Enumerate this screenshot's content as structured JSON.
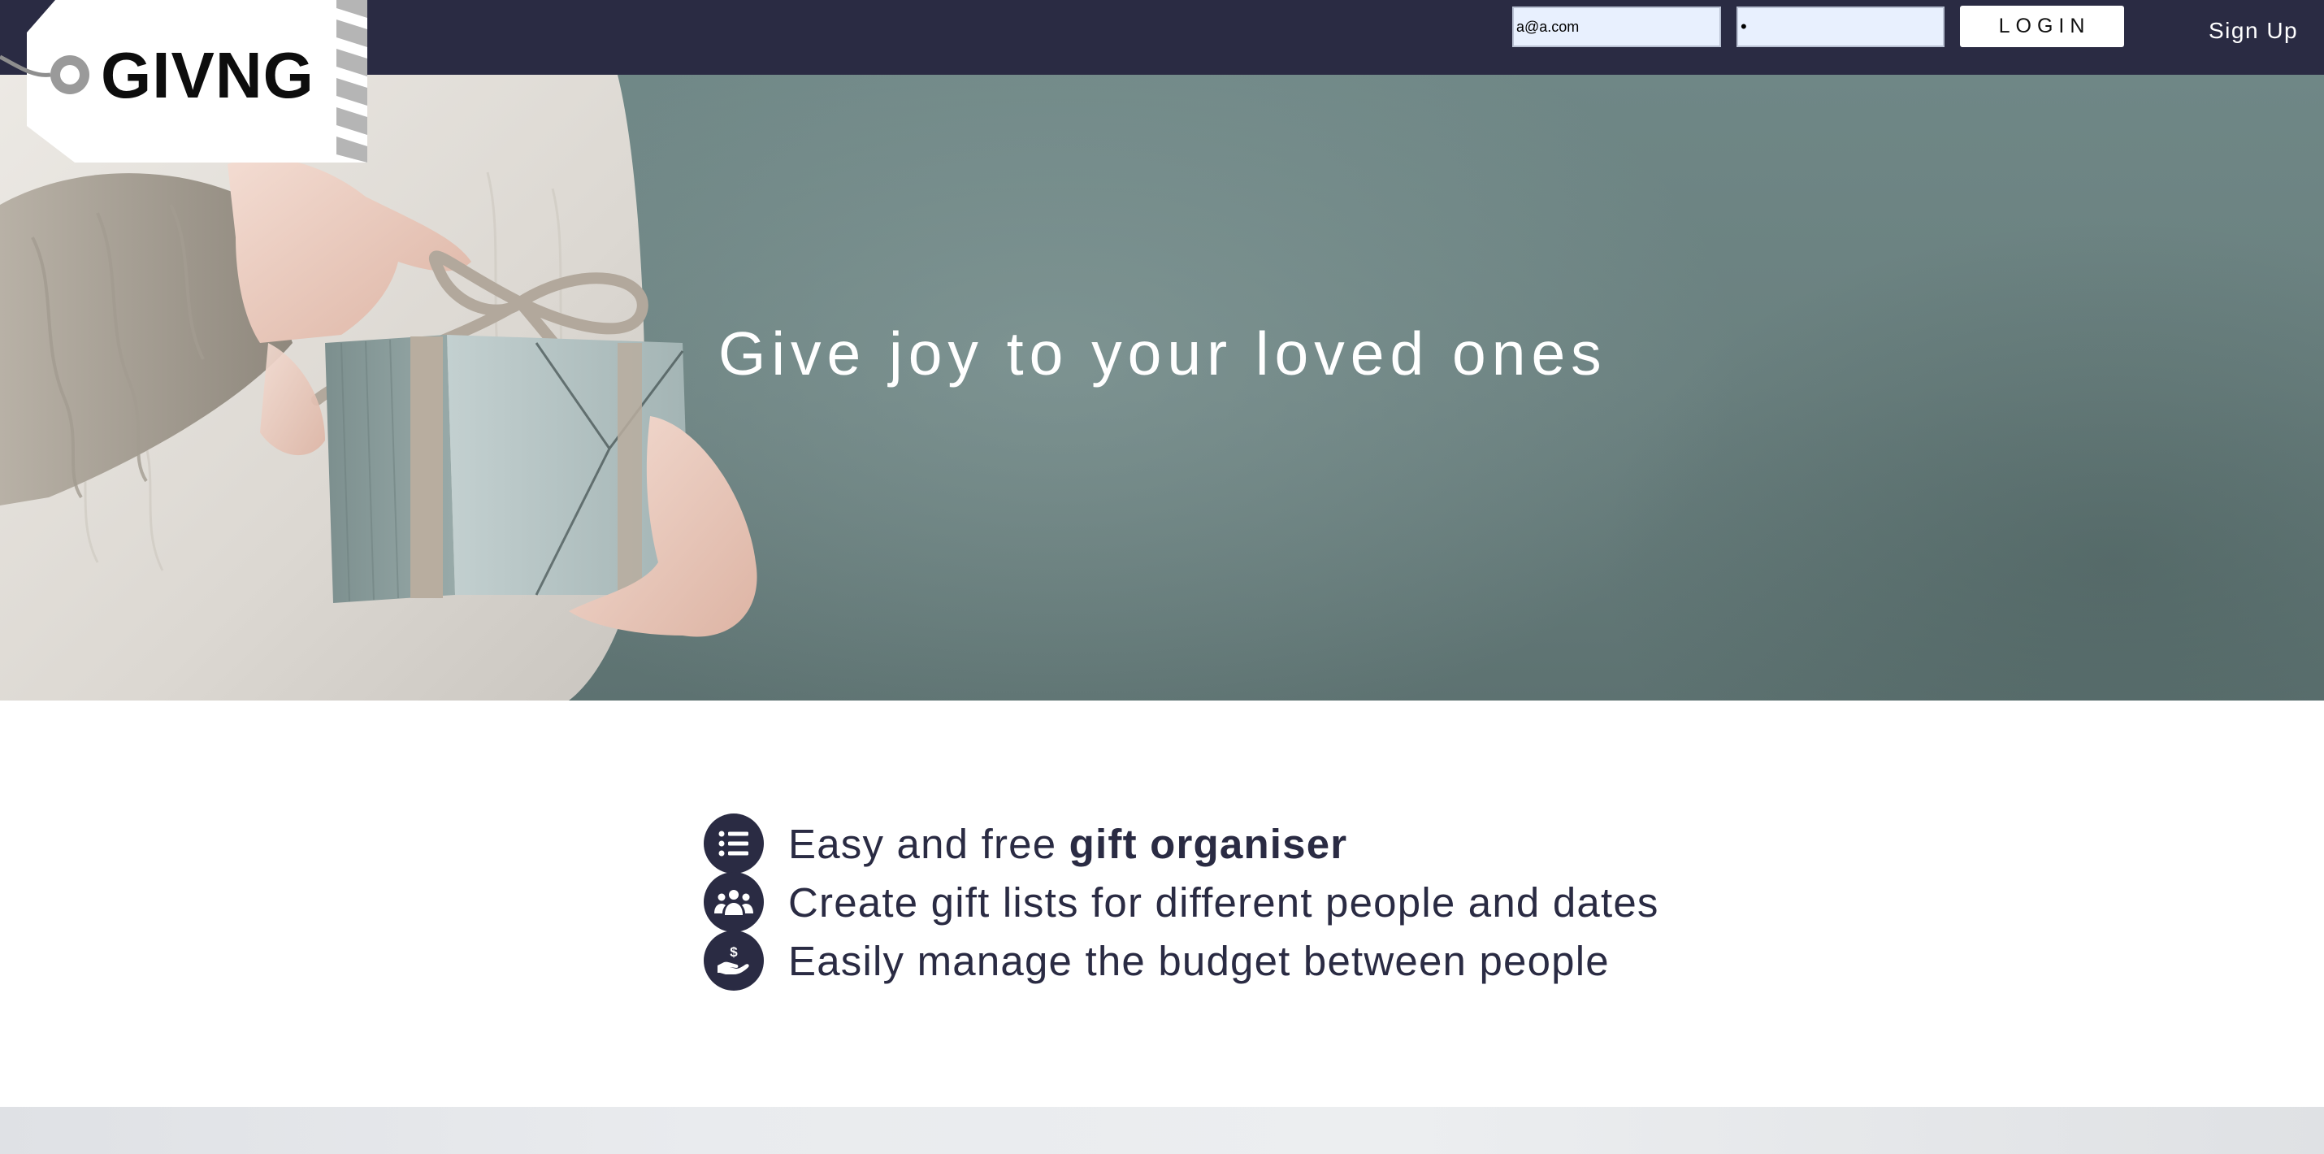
{
  "navbar": {
    "email_value": "a@a.com",
    "password_value": "•",
    "login_label": "LOGIN",
    "signup_label": "Sign Up",
    "background": "#2a2b43"
  },
  "logo": {
    "text": "GIVNG"
  },
  "hero": {
    "title": "Give joy to your loved ones"
  },
  "features": [
    {
      "icon": "list-icon",
      "text": "Easy and free ",
      "bold": "gift organiser"
    },
    {
      "icon": "people-group-icon",
      "text": "Create gift lists for different people and dates",
      "bold": ""
    },
    {
      "icon": "hand-money-icon",
      "text": "Easily manage the budget between people",
      "bold": ""
    }
  ],
  "colors": {
    "brand_dark": "#2a2b43",
    "hero_teal": "#6f8786",
    "input_fill": "#e8f0fe"
  }
}
